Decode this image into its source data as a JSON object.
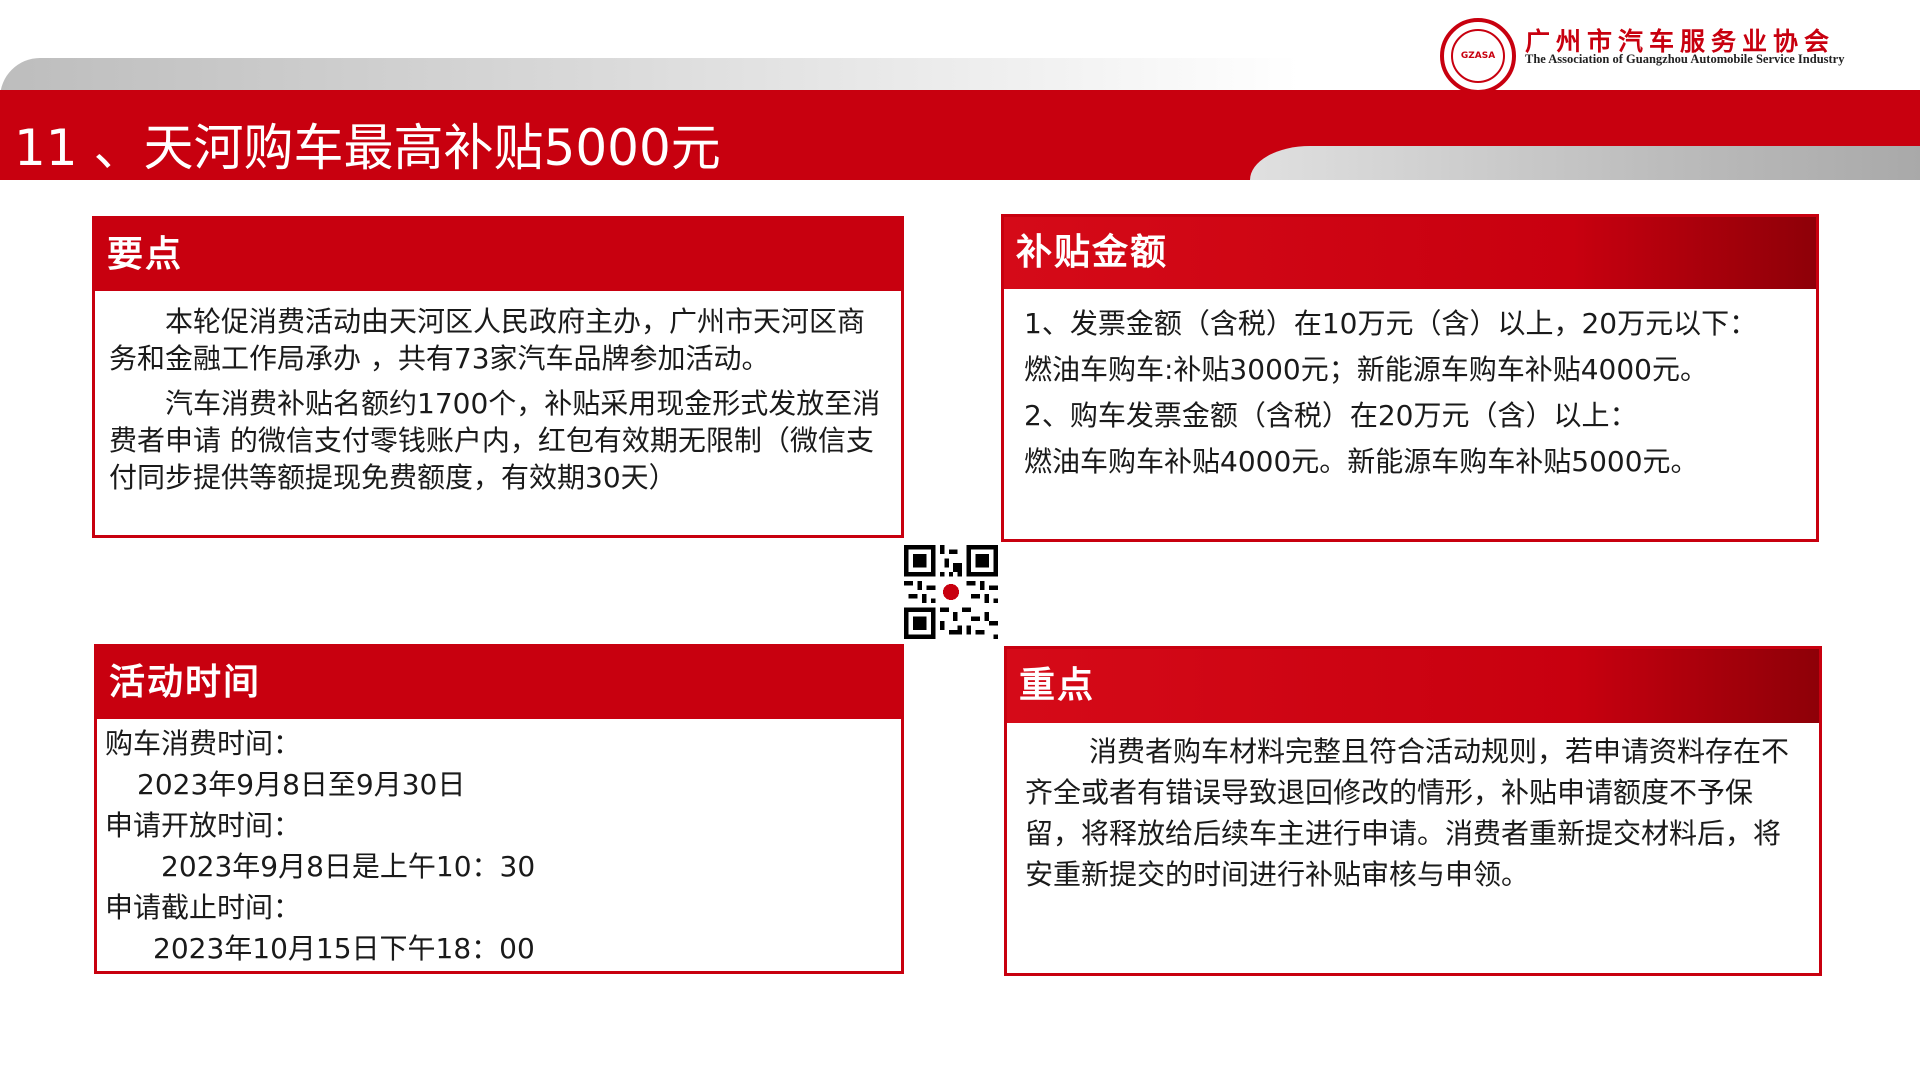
{
  "header": {
    "title": "11 、天河购车最高补贴5000元",
    "org_name_cn": "广州市汽车服务业协会",
    "org_name_en": "The Association of Guangzhou Automobile Service Industry",
    "logo_text": "GZASA",
    "brand_color": "#c8000f"
  },
  "key_points": {
    "heading": "要点",
    "paragraphs": [
      "本轮促消费活动由天河区人民政府主办，广州市天河区商务和金融工作局承办 ，共有73家汽车品牌参加活动。",
      "汽车消费补贴名额约1700个，补贴采用现金形式发放至消费者申请 的微信支付零钱账户内，红包有效期无限制（微信支付同步提供等额提现免费额度，有效期30天）"
    ]
  },
  "subsidy_amount": {
    "heading": "补贴金额",
    "lines": [
      "1、发票金额（含税）在10万元（含）以上，20万元以下：",
      "燃油车购车:补贴3000元；新能源车购车补贴4000元。",
      "2、购车发票金额（含税）在20万元（含）以上：",
      "燃油车购车补贴4000元。新能源车购车补贴5000元。"
    ]
  },
  "activity_time": {
    "heading": "活动时间",
    "purchase_label": "购车消费时间：",
    "purchase_value": "2023年9月8日至9月30日",
    "open_label": "申请开放时间：",
    "open_value": "2023年9月8日是上午10：30",
    "deadline_label": "申请截止时间：",
    "deadline_value": "2023年10月15日下午18：00"
  },
  "important": {
    "heading": "重点",
    "paragraph": "消费者购车材料完整且符合活动规则，若申请资料存在不齐全或者有错误导致退回修改的情形，补贴申请额度不予保留，将释放给后续车主进行申请。消费者重新提交材料后，将安重新提交的时间进行补贴审核与申领。"
  }
}
